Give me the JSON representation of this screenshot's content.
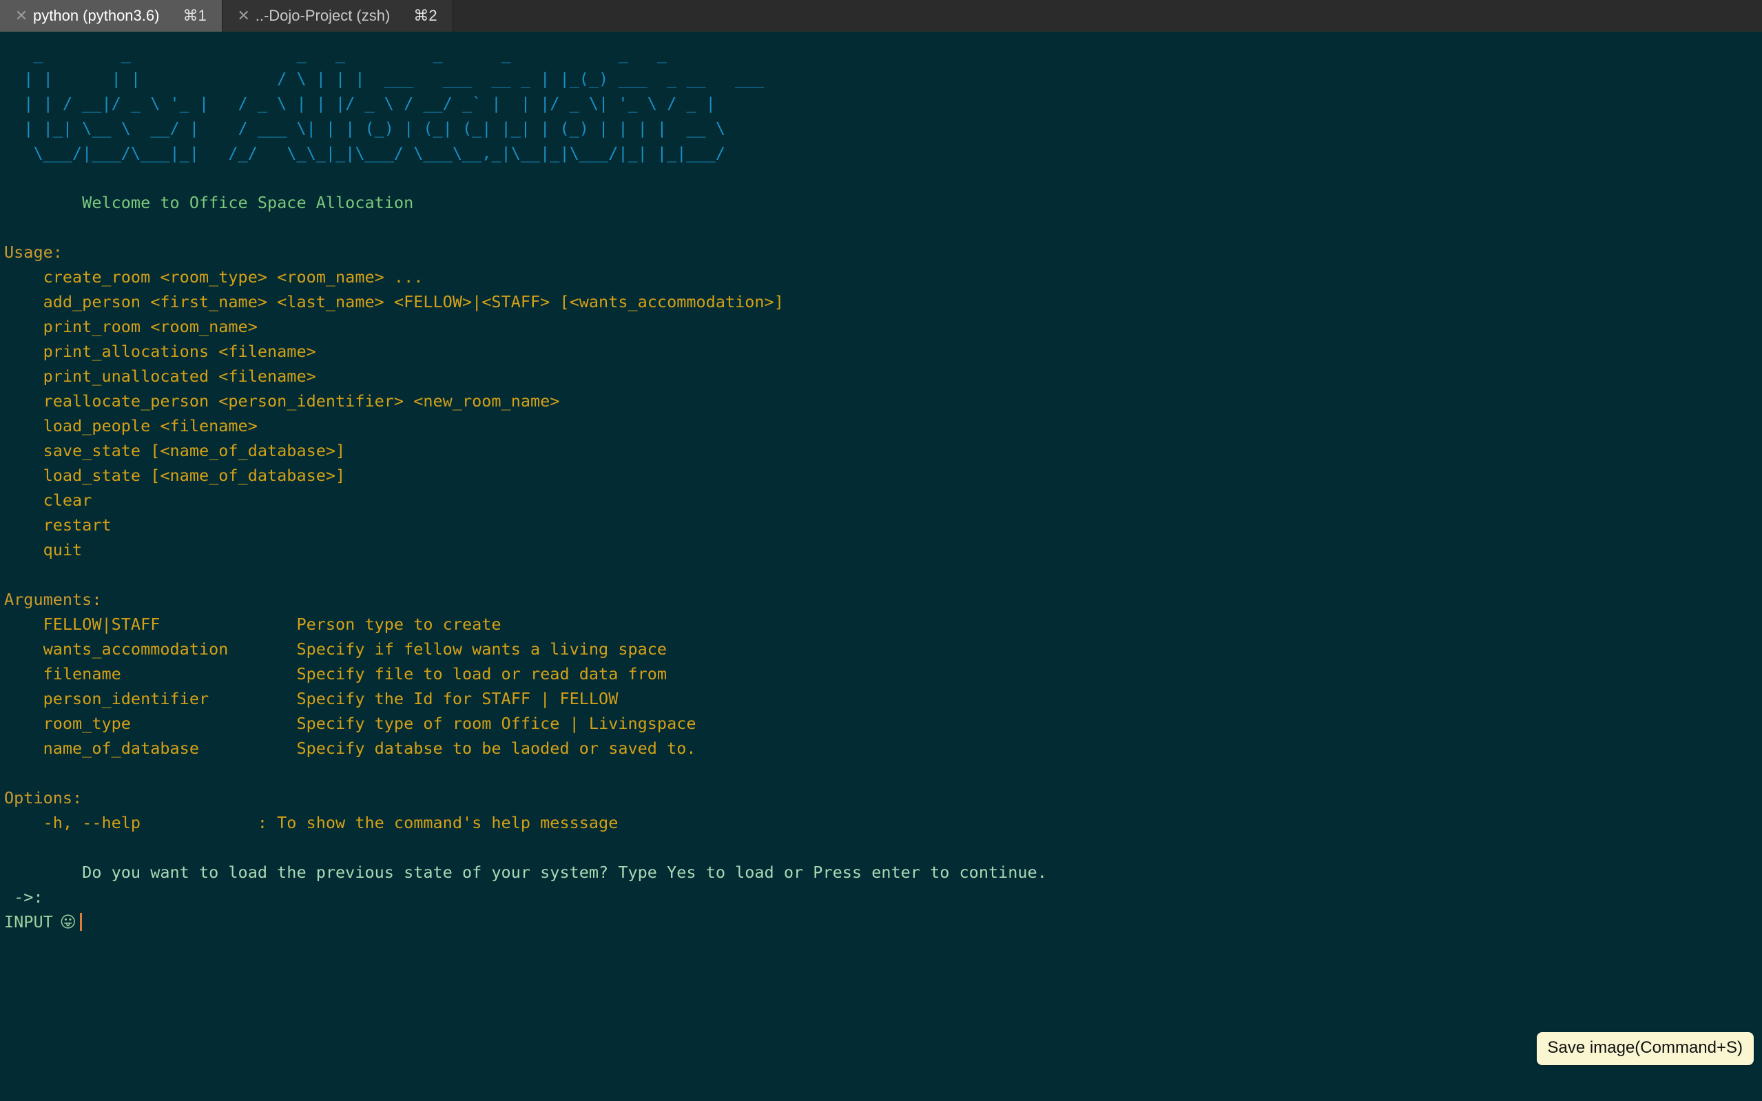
{
  "window": {
    "tabs": [
      {
        "close_icon": "✕",
        "title": "python (python3.6)",
        "shortcut": "⌘1",
        "active": true
      },
      {
        "close_icon": "✕",
        "title": "..-Dojo-Project (zsh)",
        "shortcut": "⌘2",
        "active": false
      }
    ]
  },
  "terminal": {
    "banner_ascii": "   _        _                 _   _         _      _           _   _\n  | |      | |              / \\ | | |  ___   ___  __ _ | |_(_) ___  _ __   ___\n  | | / __|/ _ \\ '_ |   / _ \\ | | |/ _ \\ / __/ _` |  | |/ _ \\| '_ \\ / _ |\n  | |_| \\__ \\  __/ |    / ___ \\| | | (_) | (_| (_| |_| | (_) | | | |  __ \\\n   \\___/|___/\\___|_|   /_/   \\_\\_|_|\\___/ \\___\\__,_|\\__|_|\\___/|_| |_|___/",
    "welcome": "        Welcome to Office Space Allocation",
    "usage_heading": "Usage:",
    "usage_commands": [
      "    create_room <room_type> <room_name> ...",
      "    add_person <first_name> <last_name> <FELLOW>|<STAFF> [<wants_accommodation>]",
      "    print_room <room_name>",
      "    print_allocations <filename>",
      "    print_unallocated <filename>",
      "    reallocate_person <person_identifier> <new_room_name>",
      "    load_people <filename>",
      "    save_state [<name_of_database>]",
      "    load_state [<name_of_database>]",
      "    clear",
      "    restart",
      "    quit"
    ],
    "arguments_heading": "Arguments:",
    "arguments_rows": [
      {
        "name": "FELLOW|STAFF",
        "description": "Person type to create"
      },
      {
        "name": "wants_accommodation",
        "description": "Specify if fellow wants a living space"
      },
      {
        "name": "filename",
        "description": "Specify file to load or read data from"
      },
      {
        "name": "person_identifier",
        "description": "Specify the Id for STAFF | FELLOW"
      },
      {
        "name": "room_type",
        "description": "Specify type of room Office | Livingspace"
      },
      {
        "name": "name_of_database",
        "description": "Specify databse to be laoded or saved to."
      }
    ],
    "options_heading": "Options:",
    "options_rows": [
      {
        "flag": "-h, --help",
        "description": ": To show the command's help messsage"
      }
    ],
    "question": "        Do you want to load the previous state of your system? Type Yes to load or Press enter to continue.",
    "prompt_arrow": " ->:",
    "input_label": "INPUT",
    "input_emoji": "😛",
    "input_value": ""
  },
  "overlay": {
    "save_button_label": "Save image(Command+S)"
  },
  "colors": {
    "background": "#022b33",
    "banner": "#1a8fc4",
    "welcome_green": "#7bc87b",
    "usage_orange": "#cc9a2e",
    "prompt_green": "#a9d9b5",
    "cursor_orange": "#e07b39",
    "tab_active_bg": "#595959",
    "tab_inactive_bg": "#333333",
    "save_button_bg": "#faf6d2"
  }
}
